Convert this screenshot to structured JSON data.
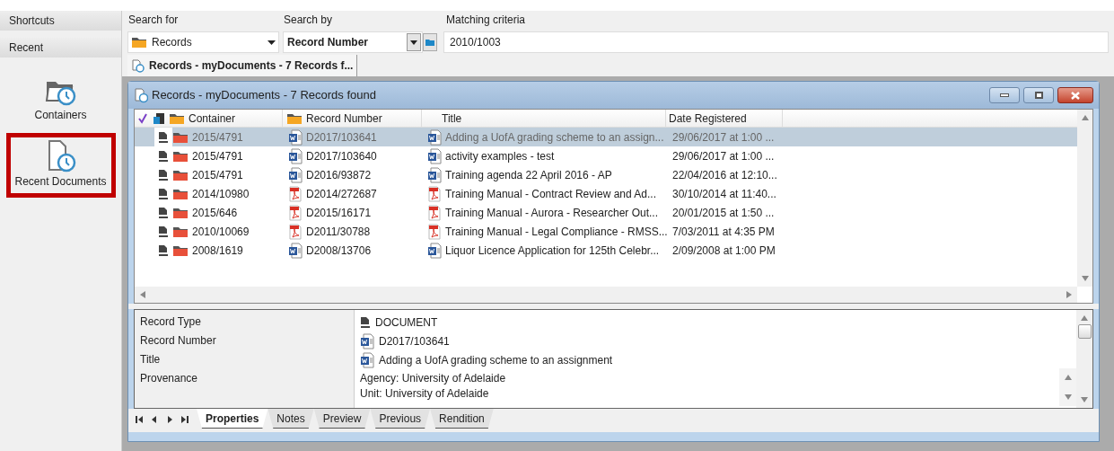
{
  "sidebar": {
    "sections": [
      {
        "label": "Shortcuts"
      },
      {
        "label": "Recent"
      }
    ],
    "items": [
      {
        "label": "Containers",
        "kind": "containers",
        "selected": false
      },
      {
        "label": "Recent Documents",
        "kind": "documents",
        "selected": true
      }
    ]
  },
  "search": {
    "search_for": {
      "label": "Search for",
      "value": "Records"
    },
    "search_by": {
      "label": "Search by",
      "value": "Record Number"
    },
    "matching_criteria": {
      "label": "Matching criteria",
      "value": "2010/1003"
    }
  },
  "tabs": [
    {
      "label": "Records - myDocuments - 7 Records f...",
      "selected": true
    }
  ],
  "window": {
    "title": "Records - myDocuments - 7 Records found"
  },
  "table": {
    "columns": [
      "Container",
      "Record Number",
      "Title",
      "Date Registered"
    ],
    "rows": [
      {
        "container": "2015/4791",
        "record_number": "D2017/103641",
        "title": "Adding a UofA grading scheme to an assign...",
        "date": "29/06/2017 at 1:00 ...",
        "kind": "word",
        "selected": true
      },
      {
        "container": "2015/4791",
        "record_number": "D2017/103640",
        "title": "activity examples - test",
        "date": "29/06/2017 at 1:00 ...",
        "kind": "word",
        "selected": false
      },
      {
        "container": "2015/4791",
        "record_number": "D2016/93872",
        "title": "Training agenda 22 April 2016 - AP",
        "date": "22/04/2016 at 12:10...",
        "kind": "word",
        "selected": false
      },
      {
        "container": "2014/10980",
        "record_number": "D2014/272687",
        "title": "Training Manual - Contract Review and Ad...",
        "date": "30/10/2014 at 11:40...",
        "kind": "pdf",
        "selected": false
      },
      {
        "container": "2015/646",
        "record_number": "D2015/16171",
        "title": "Training Manual - Aurora - Researcher Out...",
        "date": "20/01/2015 at 1:50 ...",
        "kind": "pdf",
        "selected": false
      },
      {
        "container": "2010/10069",
        "record_number": "D2011/30788",
        "title": "Training Manual - Legal Compliance - RMSS...",
        "date": "7/03/2011 at 4:35 PM",
        "kind": "pdf",
        "selected": false
      },
      {
        "container": "2008/1619",
        "record_number": "D2008/13706",
        "title": "Liquor Licence Application for 125th Celebr...",
        "date": "2/09/2008 at 1:00 PM",
        "kind": "word",
        "selected": false
      }
    ]
  },
  "details": [
    {
      "label": "Record Type",
      "kind": "record_type",
      "lines": [
        "DOCUMENT"
      ]
    },
    {
      "label": "Record Number",
      "kind": "word",
      "lines": [
        "D2017/103641"
      ]
    },
    {
      "label": "Title",
      "kind": "word",
      "lines": [
        "Adding a UofA grading scheme to an assignment"
      ]
    },
    {
      "label": "Provenance",
      "kind": "text",
      "lines": [
        "Agency: University of Adelaide",
        "Unit: University of Adelaide"
      ]
    }
  ],
  "bottom_tabs": [
    {
      "label": "Properties",
      "selected": true
    },
    {
      "label": "Notes",
      "selected": false
    },
    {
      "label": "Preview",
      "selected": false
    },
    {
      "label": "Previous",
      "selected": false
    },
    {
      "label": "Rendition",
      "selected": false
    }
  ]
}
